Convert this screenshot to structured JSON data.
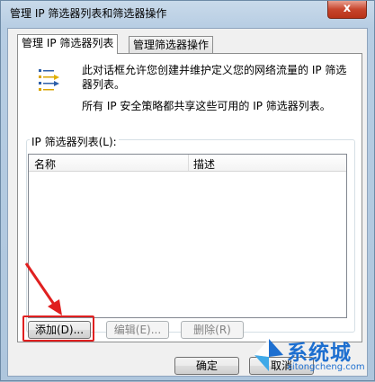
{
  "window": {
    "title": "管理 IP 筛选器列表和筛选器操作",
    "close_label": "x"
  },
  "tabs": [
    {
      "label": "管理 IP 筛选器列表",
      "active": true
    },
    {
      "label": "管理筛选器操作",
      "active": false
    }
  ],
  "description": {
    "line1": "此对话框允许您创建并维护定义您的网络流量的 IP 筛选器列表。",
    "line2": "所有 IP 安全策略都共享这些可用的 IP 筛选器列表。"
  },
  "filter_list": {
    "group_label": "IP 筛选器列表(L):",
    "columns": [
      "名称",
      "描述"
    ],
    "rows": []
  },
  "buttons": {
    "add": "添加(D)...",
    "edit": "编辑(E)...",
    "delete": "删除(R)",
    "ok": "确定",
    "cancel": "取消"
  },
  "watermark": {
    "brand": "系统城",
    "url": "xitongcheng.com"
  },
  "colors": {
    "highlight": "#e02020",
    "watermark": "#1d6fd0"
  }
}
